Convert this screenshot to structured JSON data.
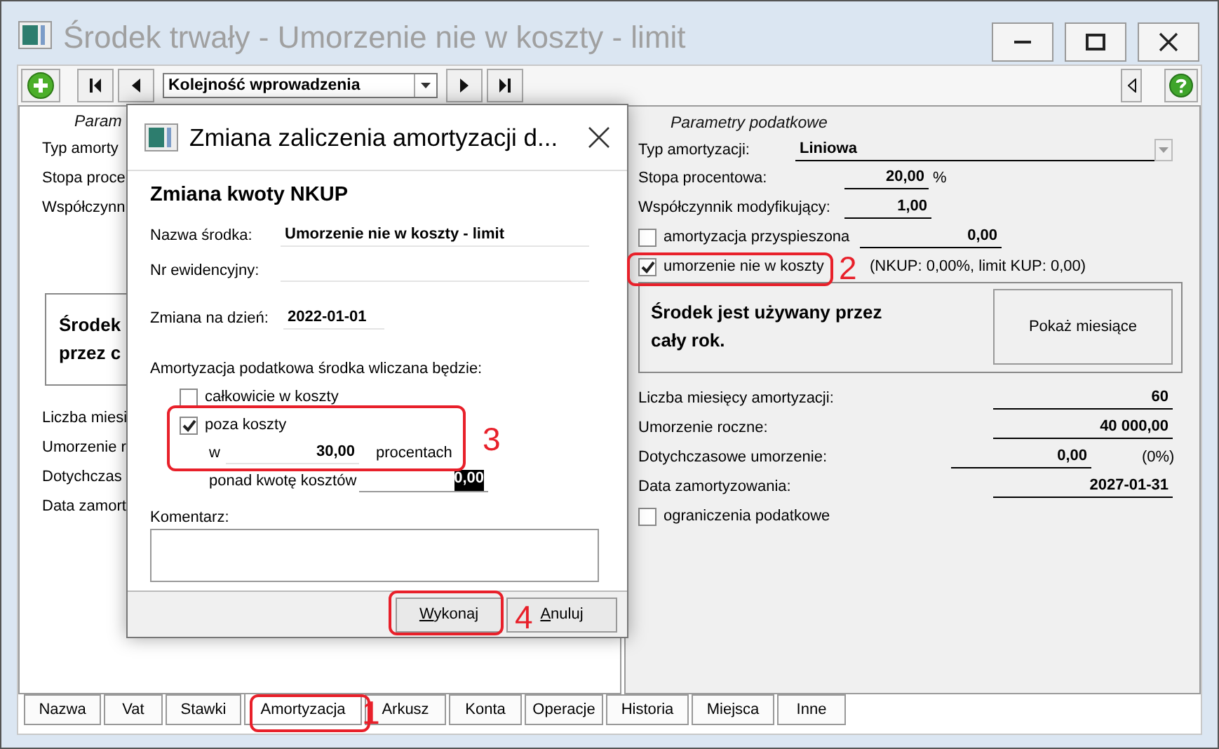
{
  "window": {
    "title": "Środek trwały - Umorzenie nie w koszty - limit"
  },
  "toolbar": {
    "sort_order": "Kolejność wprowadzenia"
  },
  "left_panel": {
    "heading": "Param",
    "labels": [
      "Typ amorty",
      "Stopa proce",
      "Współczynn"
    ],
    "usage_lines": [
      "Środek",
      "przez c"
    ],
    "summary_labels": [
      "Liczba miesi",
      "Umorzenie r",
      "Dotychczas",
      "Data zamort"
    ]
  },
  "tax_panel": {
    "heading": "Parametry podatkowe",
    "depreciation_type": {
      "label": "Typ amortyzacji:",
      "value": "Liniowa"
    },
    "rate": {
      "label": "Stopa procentowa:",
      "value": "20,00",
      "unit": "%"
    },
    "coefficient": {
      "label": "Współczynnik modyfikujący:",
      "value": "1,00"
    },
    "accelerated": {
      "label": "amortyzacja przyspieszona",
      "checked": false,
      "value": "0,00"
    },
    "nkup": {
      "label": "umorzenie nie w koszty",
      "checked": true,
      "note": "(NKUP: 0,00%, limit KUP: 0,00)"
    },
    "usage": {
      "text": "Środek jest używany przez cały rok.",
      "button": "Pokaż miesiące"
    },
    "summary": [
      {
        "label": "Liczba miesięcy amortyzacji:",
        "value": "60"
      },
      {
        "label": "Umorzenie roczne:",
        "value": "40 000,00"
      },
      {
        "label": "Dotychczasowe umorzenie:",
        "value": "0,00",
        "suffix": "(0%)"
      },
      {
        "label": "Data zamortyzowania:",
        "value": "2027-01-31"
      }
    ],
    "tax_limits": {
      "label": "ograniczenia podatkowe",
      "checked": false
    }
  },
  "tabs": [
    {
      "label": "Nazwa",
      "selected": false
    },
    {
      "label": "Vat",
      "selected": false
    },
    {
      "label": "Stawki",
      "selected": false
    },
    {
      "label": "Amortyzacja",
      "selected": true
    },
    {
      "label": "Arkusz",
      "selected": false
    },
    {
      "label": "Konta",
      "selected": false
    },
    {
      "label": "Operacje",
      "selected": false
    },
    {
      "label": "Historia",
      "selected": false
    },
    {
      "label": "Miejsca",
      "selected": false
    },
    {
      "label": "Inne",
      "selected": false
    }
  ],
  "dialog": {
    "title": "Zmiana zaliczenia amortyzacji d...",
    "heading": "Zmiana kwoty NKUP",
    "fields": [
      {
        "label": "Nazwa środka:",
        "value": "Umorzenie nie w koszty - limit"
      },
      {
        "label": "Nr ewidencyjny:"
      }
    ],
    "date": {
      "label": "Zmiana na dzień:",
      "value": "2022-01-01"
    },
    "mode_label": "Amortyzacja podatkowa środka wliczana będzie:",
    "options": [
      {
        "label": "całkowicie w koszty",
        "checked": false
      },
      {
        "label": "poza koszty",
        "checked": true
      }
    ],
    "percent": {
      "prefix": "w",
      "value": "30,00",
      "suffix": "procentach"
    },
    "above_costs": {
      "label": "ponad kwotę kosztów",
      "value": "0,00"
    },
    "comment_label": "Komentarz:",
    "buttons": [
      "Wykonaj",
      "Anuluj"
    ]
  },
  "annotations": [
    {
      "label": "1"
    },
    {
      "label": "2"
    },
    {
      "label": "3"
    },
    {
      "label": "4"
    }
  ]
}
